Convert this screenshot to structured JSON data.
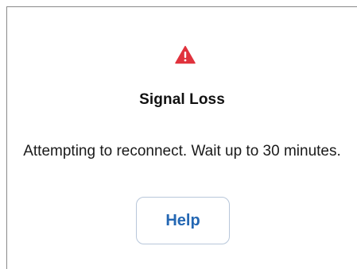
{
  "dialog": {
    "icon": "warning-triangle-icon",
    "title": "Signal Loss",
    "message": "Attempting to reconnect. Wait up to 30 minutes.",
    "help_label": "Help"
  },
  "colors": {
    "warning": "#e0323d",
    "link": "#2467b3",
    "button_border": "#b8c7da"
  }
}
